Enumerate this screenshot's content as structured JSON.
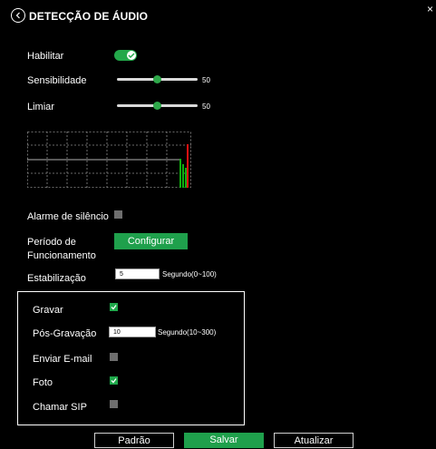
{
  "header": {
    "title": "DETECÇÃO DE ÁUDIO",
    "close_label": "×"
  },
  "enable": {
    "label": "Habilitar",
    "checked": true
  },
  "sensitivity": {
    "label": "Sensibilidade",
    "value": "50",
    "fraction": 0.5
  },
  "threshold": {
    "label": "Limiar",
    "value": "50",
    "fraction": 0.5
  },
  "silence_alarm": {
    "label": "Alarme de silêncio",
    "checked": false
  },
  "schedule": {
    "label_line1": "Período de",
    "label_line2": "Funcionamento",
    "button": "Configurar"
  },
  "stabilization": {
    "label": "Estabilização",
    "value": "5",
    "unit": "Segundo(0~100)"
  },
  "actions": {
    "record": {
      "label": "Gravar",
      "checked": true
    },
    "post_record": {
      "label": "Pós-Gravação",
      "value": "10",
      "unit": "Segundo(10~300)"
    },
    "email": {
      "label": "Enviar E-mail",
      "checked": false
    },
    "photo": {
      "label": "Foto",
      "checked": true
    },
    "sip": {
      "label": "Chamar SIP",
      "checked": false
    }
  },
  "footer": {
    "default": "Padrão",
    "save": "Salvar",
    "refresh": "Atualizar"
  },
  "colors": {
    "accent": "#1fa04c",
    "toggle": "#23a84a",
    "unchecked": "#6e6e6e",
    "graph_bar_red": "#e01010",
    "graph_bar_green": "#10b010"
  },
  "icons": {
    "back": "chevron-left-circle-icon",
    "close": "close-icon",
    "check": "check-icon"
  }
}
